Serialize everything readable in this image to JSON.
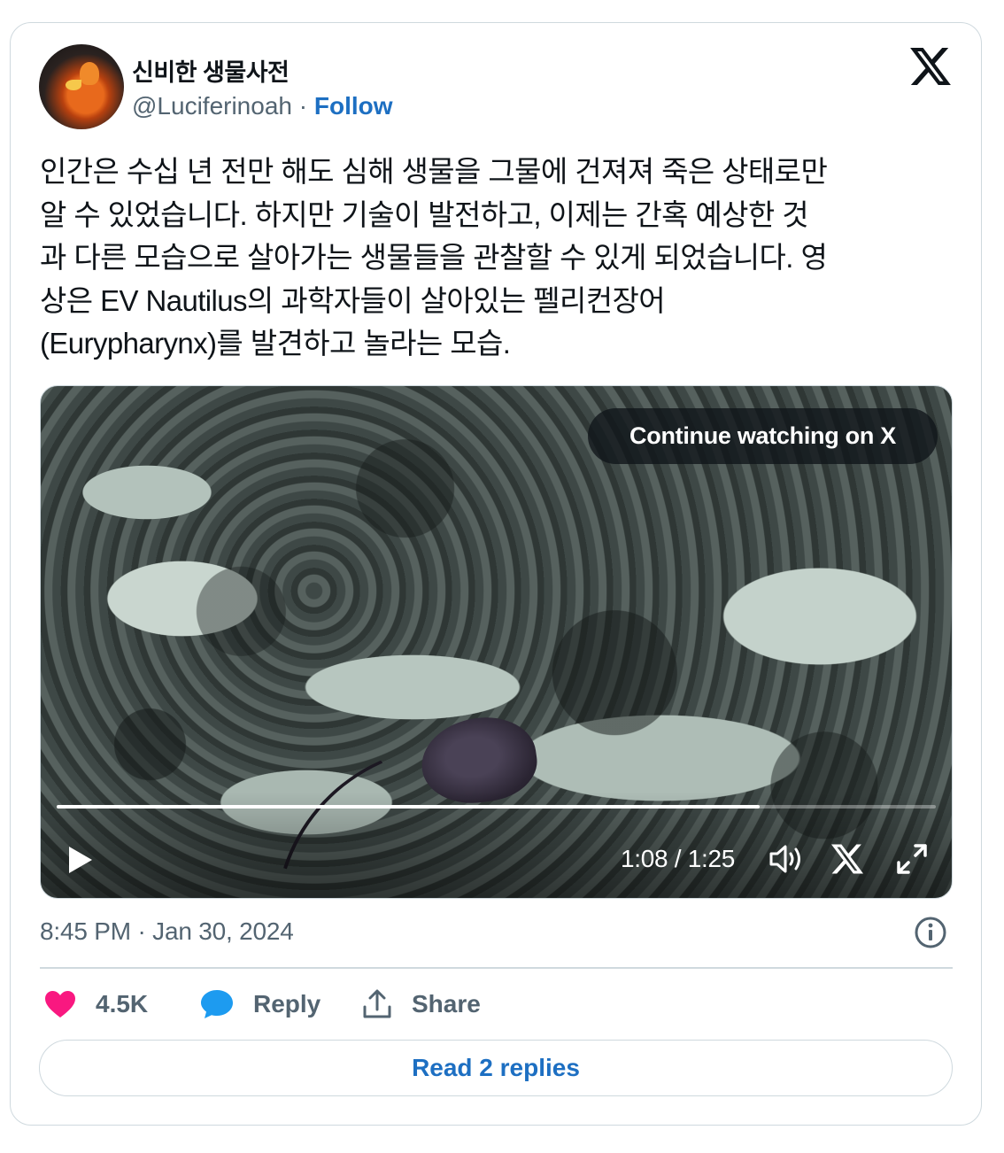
{
  "author": {
    "display_name": "신비한 생물사전",
    "handle": "@Luciferinoah",
    "separator": " · ",
    "follow_label": "Follow"
  },
  "tweet": {
    "text_lines": [
      "인간은 수십 년 전만 해도 심해 생물을 그물에 건져져 죽은 상태로만",
      "알 수 있었습니다. 하지만 기술이 발전하고, 이제는 간혹 예상한 것",
      "과 다른 모습으로 살아가는 생물들을 관찰할 수 있게 되었습니다. 영",
      "상은 EV Nautilus의 과학자들이 살아있는 펠리컨장어",
      "(Eurypharynx)를 발견하고 놀라는 모습."
    ],
    "timestamp": "8:45 PM · Jan 30, 2024"
  },
  "video": {
    "continue_label": "Continue watching on X",
    "time_display": "1:08 / 1:25",
    "progress_fraction": 0.8
  },
  "actions": {
    "like_count": "4.5K",
    "reply_label": "Reply",
    "share_label": "Share",
    "read_replies_label": "Read 2 replies"
  },
  "icons": {
    "brand": "x-logo-icon",
    "like": "heart-icon",
    "reply": "speech-bubble-icon",
    "share": "share-upload-icon",
    "info": "info-icon",
    "play": "play-icon",
    "volume": "volume-icon",
    "fullscreen": "fullscreen-icon"
  },
  "colors": {
    "link_blue": "#1d6fc2",
    "like_pink": "#f91880",
    "reply_blue": "#1d9bf0",
    "muted_text": "#536471",
    "border": "#cfd9de"
  }
}
